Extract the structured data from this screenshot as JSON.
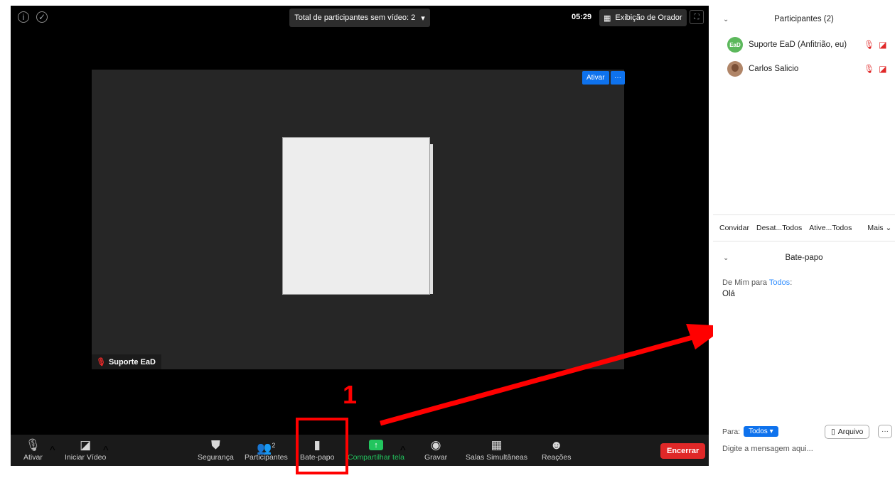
{
  "meeting": {
    "top_dropdown_label": "Total de participantes sem vídeo: 2",
    "timer": "05:29",
    "view_label": "Exibição de Orador",
    "video_ativar_label": "Ativar",
    "video_more_label": "···",
    "speaker_name": "Suporte EaD"
  },
  "toolbar": {
    "mute_label": "Ativar",
    "video_label": "Iniciar Vídeo",
    "security_label": "Segurança",
    "participants_label": "Participantes",
    "participants_count": "2",
    "chat_label": "Bate-papo",
    "share_label": "Compartilhar tela",
    "record_label": "Gravar",
    "breakout_label": "Salas Simultâneas",
    "reactions_label": "Reações",
    "end_label": "Encerrar"
  },
  "annotation": {
    "number": "1",
    "color": "#ff0000"
  },
  "participants_panel": {
    "title": "Participantes (2)",
    "participants": [
      {
        "name": "Suporte EaD (Anfitrião, eu)",
        "avatar_text": "EaD"
      },
      {
        "name": "Carlos Salicio"
      }
    ],
    "actions": {
      "invite": "Convidar",
      "mute_all": "Desat...Todos",
      "unmute_all": "Ative...Todos",
      "more": "Mais"
    }
  },
  "chat_panel": {
    "title": "Bate-papo",
    "messages": [
      {
        "from": "De Mim para",
        "to": "Todos",
        "text": "Olá"
      }
    ],
    "to_label": "Para:",
    "recipient": "Todos",
    "file_button": "Arquivo",
    "more_button": "···",
    "input_placeholder": "Digite a mensagem aqui..."
  },
  "colors": {
    "accent_blue": "#0e72ed",
    "share_green": "#22c55e",
    "end_red": "#e02828"
  }
}
